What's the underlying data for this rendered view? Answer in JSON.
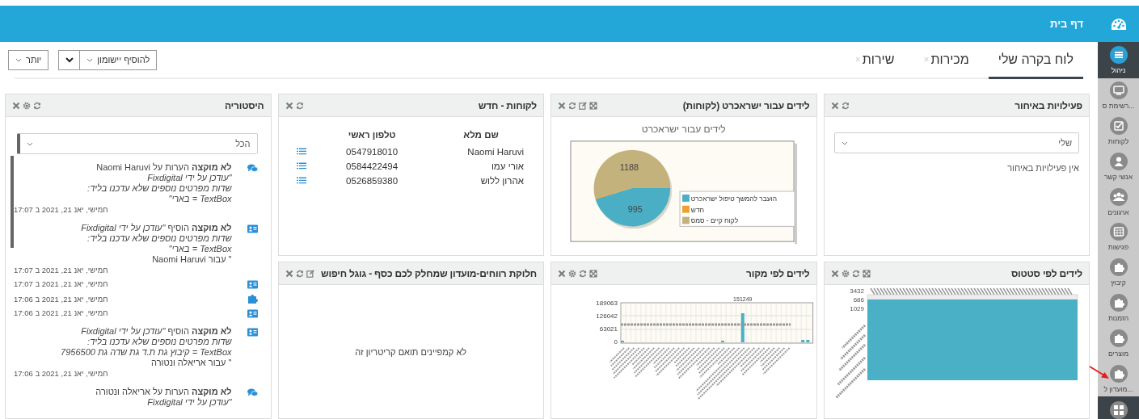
{
  "header": {
    "title": "דף בית"
  },
  "sidebar": {
    "items": [
      {
        "label": "ניהול",
        "kind": "menu",
        "selected": true
      },
      {
        "label": "רשימת ס...",
        "kind": "monitor",
        "selected": false
      },
      {
        "label": "לקוחות",
        "kind": "checkbox",
        "selected": false
      },
      {
        "label": "אנשי קשר",
        "kind": "person",
        "selected": false
      },
      {
        "label": "ארגונים",
        "kind": "group",
        "selected": false
      },
      {
        "label": "פגישות",
        "kind": "calendar",
        "selected": false
      },
      {
        "label": "קיבוץ",
        "kind": "puzzle",
        "selected": false
      },
      {
        "label": "הזמנות",
        "kind": "puzzle",
        "selected": false
      },
      {
        "label": "מוצרים",
        "kind": "puzzle",
        "selected": false
      },
      {
        "label": "מועדון ל...",
        "kind": "puzzle",
        "selected": false
      },
      {
        "kind": "grid",
        "selected": false
      }
    ]
  },
  "annotation": {
    "kind": "arrow"
  },
  "tabs": [
    {
      "label": "לוח בקרה שלי",
      "selected": true
    },
    {
      "label": "מכירות",
      "close": "×",
      "selected": false
    },
    {
      "label": "שירות",
      "close": "×",
      "selected": false
    }
  ],
  "toolbar": {
    "add_widget": "להוסיף יישומון",
    "more": "יותר"
  },
  "panels": {
    "late_activities": {
      "title": "פעילויות באיחור",
      "tools": [
        {
          "kind": "close"
        },
        {
          "kind": "refresh"
        }
      ],
      "filter": "שלי",
      "empty_text": "אין פעילויות באיחור"
    },
    "isracard": {
      "title": "לידים עבור ישראכרט (לקוחות)",
      "tools": [
        {
          "kind": "close"
        },
        {
          "kind": "refresh"
        },
        {
          "kind": "edit"
        },
        {
          "kind": "expand"
        }
      ],
      "chart_data": {
        "type": "pie",
        "title": "לידים עבור ישראכרט",
        "categories": [
          "הועבר להמשך טיפול ישראכרט",
          "חדש",
          "לקוח קיים - סמס"
        ],
        "values": [
          995,
          10,
          1188
        ],
        "colors": [
          "#4aafc4",
          "#f0a030",
          "#c4b27c"
        ],
        "data_labels": true,
        "value_labels": [
          "995",
          null,
          "1188"
        ],
        "legend": "right"
      }
    },
    "new_customers": {
      "title": "לקוחות - חדש",
      "tools": [
        {
          "kind": "close"
        },
        {
          "kind": "refresh"
        }
      ],
      "columns": [
        "שם מלא",
        "טלפון ראשי"
      ],
      "rows": [
        [
          "Naomi Haruvi",
          "0547918010"
        ],
        [
          "אורי  עמו",
          "0584422494"
        ],
        [
          "אהרון ללוש",
          "0526859380"
        ]
      ]
    },
    "history": {
      "title": "היסטוריה",
      "tools": [
        {
          "kind": "close"
        },
        {
          "kind": "settings"
        },
        {
          "kind": "refresh"
        }
      ],
      "filter": "הכל",
      "entries": [
        {
          "kind": "comment",
          "lines": [
            "**לא מוקצה** הערות על Naomi Haruvi",
            "*\"עודכן על ידי Fixdigital*",
            "*שדות מפרטים נוספים שלא עדכנו בליד:*",
            "*TextBox = בארי\"*"
          ],
          "date": "חמישי, יאנ 21, 2021 ב 17:07"
        },
        {
          "kind": "card",
          "lines": [
            "**לא מוקצה** הוסיף *\"עודכן על ידי Fixdigital*",
            "*שדות מפרטים נוספים שלא עדכנו בליד:*",
            "*TextBox = בארי\"*",
            "\" עבור Naomi Haruvi"
          ],
          "date": "חמישי, יאנ 21, 2021 ב 17:07"
        },
        {
          "kind": "card",
          "date": "חמישי, יאנ 21, 2021 ב 17:07"
        },
        {
          "kind": "puzzle",
          "date": "חמישי, יאנ 21, 2021 ב 17:06"
        },
        {
          "kind": "card",
          "date": "חמישי, יאנ 21, 2021 ב 17:06"
        },
        {
          "kind": "card",
          "lines": [
            "**לא מוקצה** הוסיף *\"עודכן על ידי Fixdigital*",
            "*שדות מפרטים נוספים שלא עדכנו בליד:*",
            "*TextBox = קיבוץ גת ת.ד גת שדה גת 7956500*",
            "\" עבור אריאלה ונטורה"
          ],
          "date": "חמישי, יאנ 21, 2021 ב 17:06"
        },
        {
          "kind": "comment",
          "lines": [
            "**לא מוקצה** הערות על אריאלה ונטורה",
            "*\"עודכן על ידי Fixdigital*"
          ]
        }
      ]
    },
    "lead_status": {
      "title": "לידים לפי סטטוס",
      "tools": [
        {
          "kind": "close"
        },
        {
          "kind": "settings"
        },
        {
          "kind": "refresh"
        },
        {
          "kind": "expand"
        }
      ],
      "tick_labels": [
        "3432",
        "686",
        "1029"
      ]
    },
    "lead_source": {
      "title": "לידים לפי מקור",
      "tools": [
        {
          "kind": "close"
        },
        {
          "kind": "settings"
        },
        {
          "kind": "refresh"
        },
        {
          "kind": "expand"
        }
      ],
      "tick_labels": [
        "189063",
        "126042",
        "63021",
        "0"
      ],
      "peak_label": "151249"
    },
    "profit_share": {
      "title": "חלוקת רווחים-מועדון שמחלק לכם כסף - גוגל חיפוש",
      "tools": [
        {
          "kind": "close"
        },
        {
          "kind": "refresh"
        },
        {
          "kind": "edit"
        }
      ],
      "empty_text": "לא קמפיינים תואם קריטריון זה"
    }
  }
}
